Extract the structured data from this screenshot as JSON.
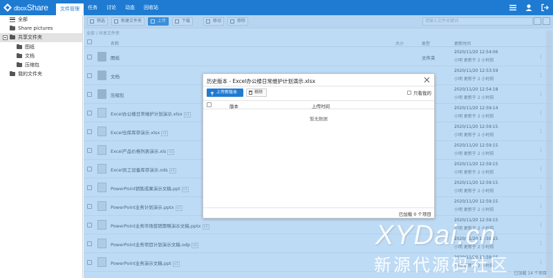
{
  "app": {
    "logo_text": "dbox",
    "logo_suffix": "Share",
    "active_tab": "文件管理",
    "nav": [
      "任务",
      "讨论",
      "动态",
      "回收站"
    ]
  },
  "sidebar": {
    "items": [
      {
        "label": "全部",
        "icon": "list-icon"
      },
      {
        "label": "Share pictures",
        "icon": "folder-icon"
      },
      {
        "label": "共享文件夹",
        "icon": "folder-icon",
        "expanded": true,
        "selected": true
      },
      {
        "label": "图纸",
        "icon": "folder-icon"
      },
      {
        "label": "文档",
        "icon": "folder-icon"
      },
      {
        "label": "压缩包",
        "icon": "folder-icon"
      },
      {
        "label": "我的文件夹",
        "icon": "folder-icon"
      }
    ]
  },
  "toolbar": {
    "filter": "筛选",
    "new_folder": "新建文件夹",
    "upload": "上传",
    "download": "下载",
    "move": "移动",
    "remove": "移除",
    "search_placeholder": "请输入文件关键词"
  },
  "breadcrumb": "全部 / 共享文件夹",
  "table": {
    "headers": {
      "name": "名称",
      "size": "大小",
      "type": "类型",
      "updated": "更新时间"
    },
    "rows": [
      {
        "name": "图纸",
        "kind": "folder",
        "type": "文件夹",
        "date": "2020/11/20 12:54:06",
        "by": "小明 更新于 2 小时前"
      },
      {
        "name": "文档",
        "kind": "folder",
        "type": "文件夹",
        "date": "2020/11/20 12:53:59",
        "by": "小明 更新于 2 小时前"
      },
      {
        "name": "压缩包",
        "kind": "folder",
        "type": "文件夹",
        "date": "2020/11/20 12:54:18",
        "by": "小明 更新于 2 小时前"
      },
      {
        "name": "Excel办公楼日常维护计划演示.xlsx",
        "kind": "file",
        "version": "v1",
        "type": "",
        "date": "2020/11/20 12:59:14",
        "by": "小明 更新于 2 小时前"
      },
      {
        "name": "Excel仓库库存演示.xlsx",
        "kind": "file",
        "version": "v1",
        "type": "",
        "date": "2020/11/20 12:59:15",
        "by": "小明 更新于 2 小时前"
      },
      {
        "name": "Excel产品价格列表演示.xls",
        "kind": "file",
        "version": "v1",
        "type": "",
        "date": "2020/11/20 12:59:15",
        "by": "小明 更新于 2 小时前"
      },
      {
        "name": "Excel员工设备库存演示.ods",
        "kind": "file",
        "version": "v1",
        "type": "Office",
        "date": "2020/11/20 12:59:15",
        "by": "小明 更新于 2 小时前"
      },
      {
        "name": "PowerPoint销售成果演示文稿.ppt",
        "kind": "file",
        "version": "v1",
        "type": "Point",
        "date": "2020/11/20 12:59:15",
        "by": "小明 更新于 2 小时前"
      },
      {
        "name": "PowerPoint业务计划演示.pptx",
        "kind": "file",
        "version": "v1",
        "type": "Point",
        "date": "2020/11/20 12:59:15",
        "by": "小明 更新于 2 小时前"
      },
      {
        "name": "PowerPoint业务市场营销策略演示文稿.pptx",
        "kind": "file",
        "version": "v1",
        "type": "",
        "date": "2020/11/20 12:59:15",
        "by": "小明 更新于 2 小时前"
      },
      {
        "name": "PowerPoint业务项目计划演示文稿.odp",
        "kind": "file",
        "version": "v1",
        "type": "",
        "date": "2020/11/20 12:59:15",
        "by": "小明 更新于 2 小时前"
      },
      {
        "name": "PowerPoint业务演示文稿.ppt",
        "kind": "file",
        "version": "v1",
        "type": "",
        "date": "2020/11/20 12:59:15",
        "by": "小明 更新于 2 小时前"
      }
    ],
    "footer_count": "已加载 14 个项目"
  },
  "dialog": {
    "title": "历史版本 - Excel办公楼日常维护计划演示.xlsx",
    "upload_button": "上传新版本",
    "remove_button": "移除",
    "only_mine": "只看我的",
    "col_version": "版本",
    "col_upload_time": "上传时间",
    "empty": "暂无数据",
    "footer": "已加载 0 个项目"
  },
  "watermark": {
    "line1": "XYDai.cn",
    "line2": "新源代源码社区"
  },
  "colors": {
    "brand": "#1e7bd1"
  }
}
